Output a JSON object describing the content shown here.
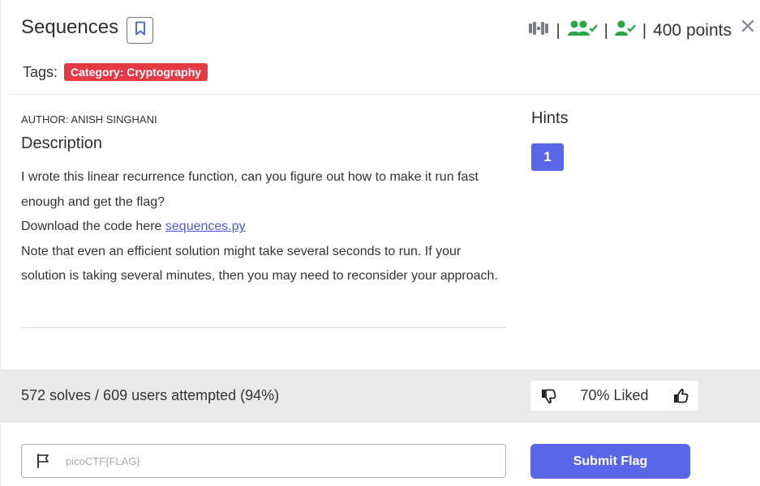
{
  "challenge": {
    "title": "Sequences",
    "points": "400 points",
    "tags_label": "Tags:",
    "tags": [
      "Category: Cryptography"
    ],
    "author": "AUTHOR: ANISH SINGHANI",
    "description_heading": "Description",
    "description": {
      "line1": "I wrote this linear recurrence function, can you figure out how to make it run fast enough and get the flag?",
      "download_prefix": "Download the code here ",
      "download_link": "sequences.py",
      "note": "Note that even an efficient solution might take several seconds to run. If your solution is taking several minutes, then you may need to reconsider your approach."
    },
    "hints_heading": "Hints",
    "hints": [
      "1"
    ],
    "solves_text": "572 solves / 609 users attempted (94%)",
    "liked_text": "70% Liked"
  },
  "flag_form": {
    "placeholder": "picoCTF{FLAG}",
    "submit_label": "Submit Flag"
  },
  "colors": {
    "accent": "#5a66e8",
    "tag": "#e63946",
    "success_green": "#28a745",
    "band_gray": "#e9eaec"
  },
  "icons": [
    "bookmark-icon",
    "difficulty-icon",
    "users-check-icon",
    "user-check-icon",
    "close-icon",
    "thumbs-down-icon",
    "thumbs-up-icon",
    "flag-icon"
  ]
}
